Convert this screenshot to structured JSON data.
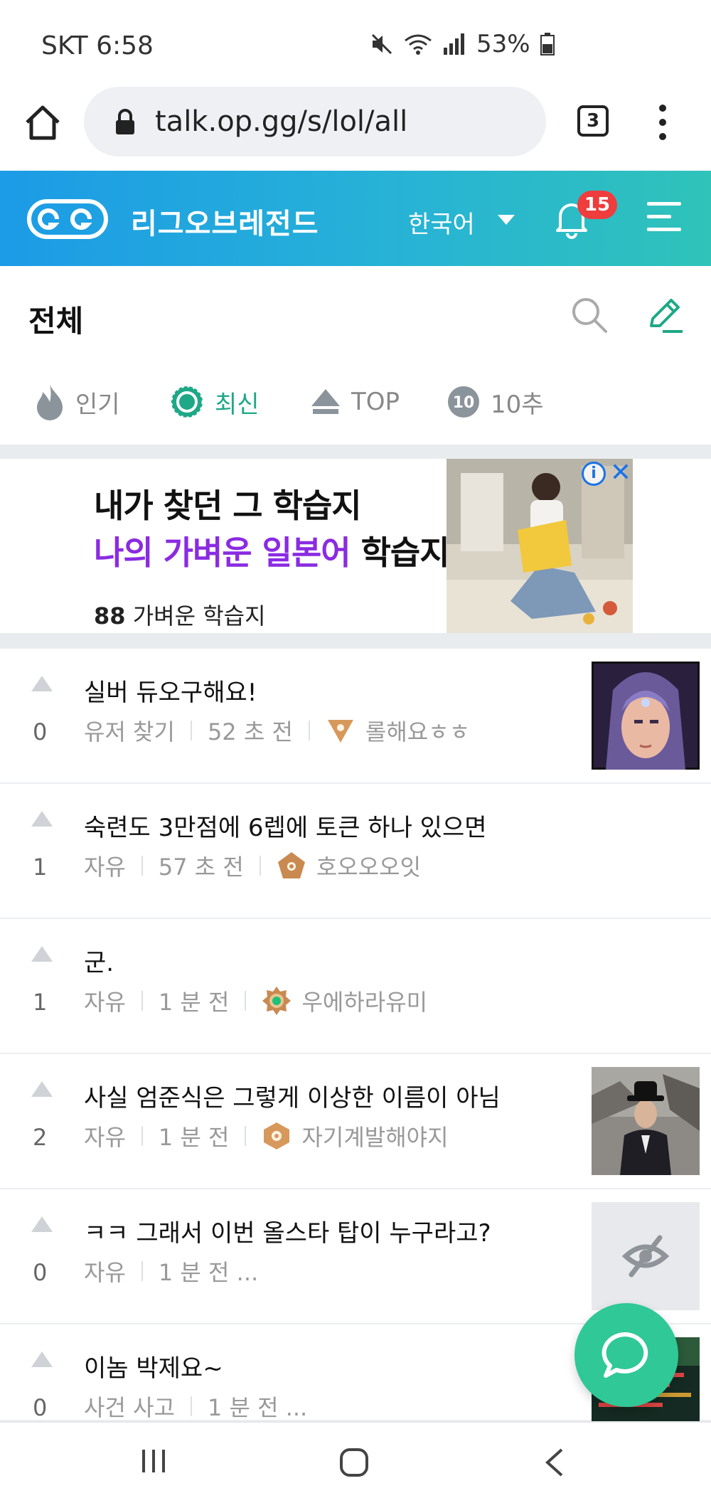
{
  "status": {
    "carrier_time": "SKT 6:58",
    "battery": "53%"
  },
  "browser": {
    "url": "talk.op.gg/s/lol/all",
    "tab_count": "3"
  },
  "header": {
    "brand": "리그오브레전드",
    "language": "한국어",
    "notification_count": "15"
  },
  "section": {
    "title": "전체"
  },
  "sort_tabs": [
    {
      "label": "인기",
      "icon": "flame-icon",
      "active": false
    },
    {
      "label": "최신",
      "icon": "recent-icon",
      "active": true
    },
    {
      "label": "TOP",
      "icon": "top-arrow-icon",
      "active": false
    },
    {
      "label": "10추",
      "icon": "ten-badge-icon",
      "badge": "10",
      "active": false
    }
  ],
  "ad": {
    "line1": "내가 찾던 그 학습지",
    "line2_highlight": "나의 가벼운 일본어",
    "line2_rest": " 학습지",
    "brand": "가벼운 학습지",
    "brand_mark": "88"
  },
  "posts": [
    {
      "votes": "0",
      "title": "실버 듀오구해요!",
      "category": "유저 찾기",
      "time": "52 초 전",
      "author": "롤해요ㅎㅎ",
      "tier": "bronze-triangle",
      "thumbnail": "champion-portrait"
    },
    {
      "votes": "1",
      "title": "숙련도 3만점에 6렙에 토큰 하나 있으면",
      "category": "자유",
      "time": "57 초 전",
      "author": "호오오오잇",
      "tier": "bronze-pentagon",
      "thumbnail": ""
    },
    {
      "votes": "1",
      "title": "군.",
      "category": "자유",
      "time": "1 분 전",
      "author": "우에하라유미",
      "tier": "emerald-badge",
      "thumbnail": ""
    },
    {
      "votes": "2",
      "title": "사실 엄준식은 그렇게 이상한 이름이 아님",
      "category": "자유",
      "time": "1 분 전",
      "author": "자기계발해야지",
      "tier": "bronze-hexagon",
      "thumbnail": "man-in-suit-photo"
    },
    {
      "votes": "0",
      "title": "ㅋㅋ 그래서 이번 올스타 탑이 누구라고?",
      "category": "자유",
      "time": "1 분 전 ...",
      "author": "",
      "tier": "",
      "thumbnail": "hidden-image"
    },
    {
      "votes": "0",
      "title": "이놈 박제요~",
      "category": "사건 사고",
      "time": "1 분 전 ...",
      "author": "",
      "tier": "",
      "thumbnail": "screenshot"
    }
  ],
  "colors": {
    "accent": "#1ea887",
    "header_start": "#1c9be6",
    "header_end": "#2fc3b9",
    "badge": "#ef3c3c",
    "fab": "#2fc896"
  }
}
